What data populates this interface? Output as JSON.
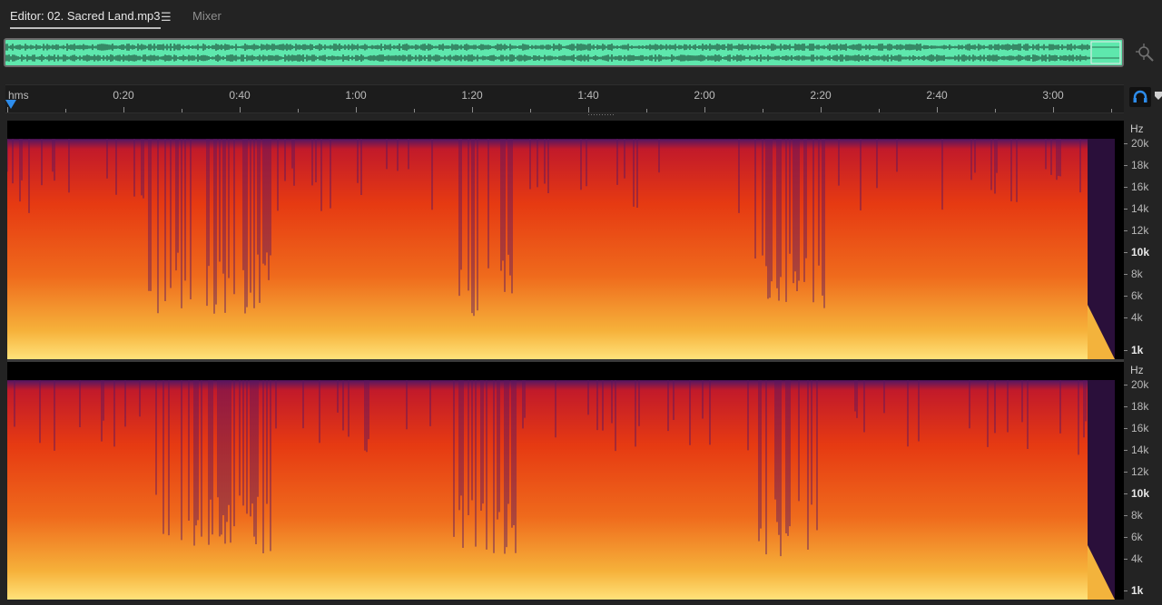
{
  "tabs": {
    "editor_label": "Editor: 02. Sacred Land.mp3",
    "menu_glyph": "☰",
    "mixer_label": "Mixer"
  },
  "timeline": {
    "unit_label": "hms",
    "time_labels": [
      "0:20",
      "0:40",
      "1:00",
      "1:20",
      "1:40",
      "2:00",
      "2:20",
      "2:40",
      "3:00"
    ],
    "duration_seconds": 192
  },
  "frequency_axis": {
    "unit_label": "Hz",
    "labels": [
      {
        "text": "20k",
        "hz": 20000
      },
      {
        "text": "18k",
        "hz": 18000
      },
      {
        "text": "16k",
        "hz": 16000
      },
      {
        "text": "14k",
        "hz": 14000
      },
      {
        "text": "12k",
        "hz": 12000
      },
      {
        "text": "10k",
        "hz": 10000
      },
      {
        "text": "8k",
        "hz": 8000
      },
      {
        "text": "6k",
        "hz": 6000
      },
      {
        "text": "4k",
        "hz": 4000
      },
      {
        "text": "1k",
        "hz": 1000
      }
    ],
    "bold_labels": [
      "10k",
      "1k"
    ]
  },
  "icons": {
    "menu": "hamburger-menu-icon",
    "zoom": "zoom-crosshair-icon",
    "headphones": "headphones-icon",
    "marker": "marker-icon",
    "playhead": "playhead-icon"
  },
  "colors": {
    "overview_wave": "#5ee8ad",
    "playhead": "#2d8ceb",
    "background": "#232323",
    "spectro_low": "#ffe27a",
    "spectro_mid": "#e63a12",
    "spectro_high": "#5a1760",
    "spectro_top": "#000000"
  }
}
